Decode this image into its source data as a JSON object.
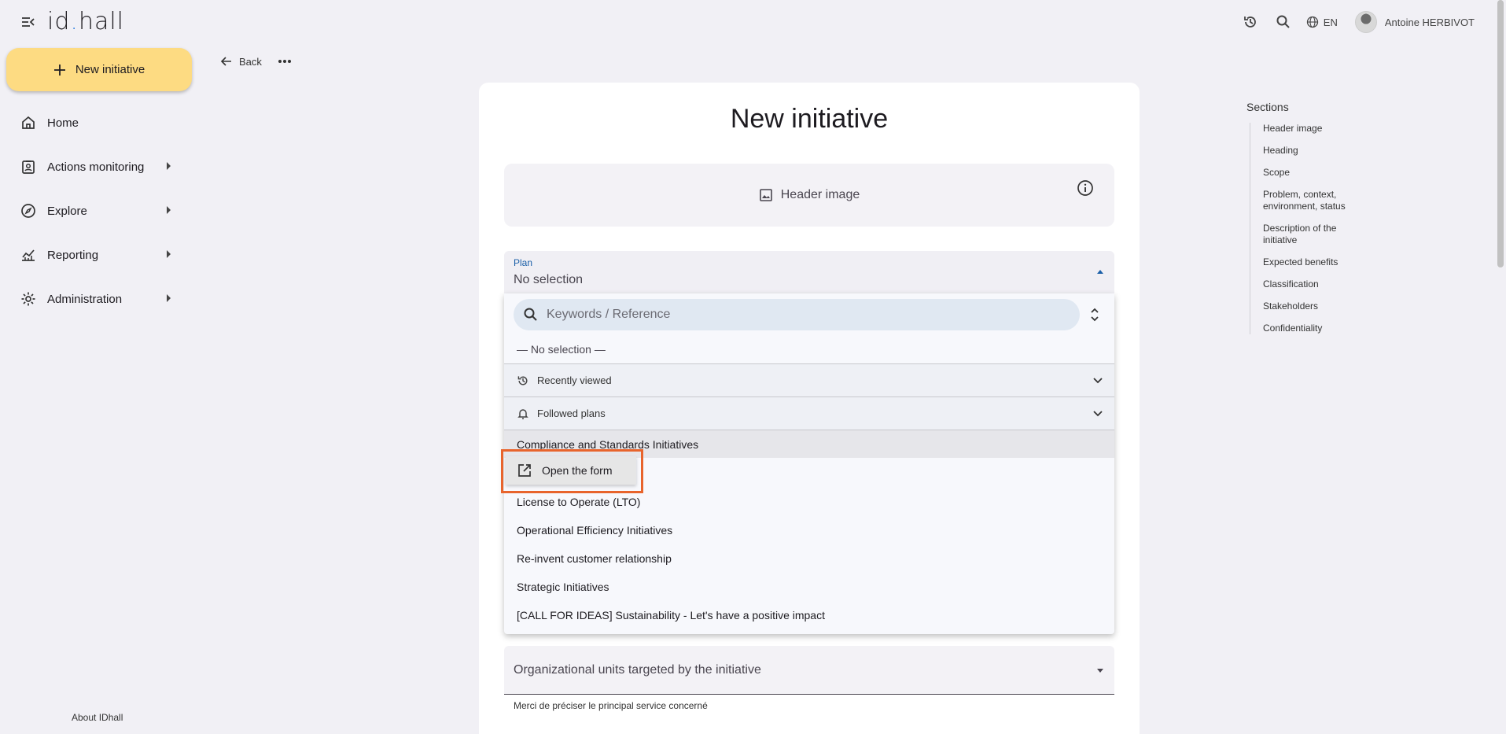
{
  "app": {
    "logo_text": "idhall"
  },
  "topbar": {
    "language": "EN",
    "user_name": "Antoine HERBIVOT"
  },
  "sidebar": {
    "new_button_label": "New initiative",
    "items": [
      {
        "label": "Home",
        "icon": "home-icon"
      },
      {
        "label": "Actions monitoring",
        "icon": "clipboard-person-icon"
      },
      {
        "label": "Explore",
        "icon": "compass-icon"
      },
      {
        "label": "Reporting",
        "icon": "chart-icon"
      },
      {
        "label": "Administration",
        "icon": "gear-icon"
      }
    ],
    "about_label": "About IDhall"
  },
  "toolbar": {
    "back_label": "Back"
  },
  "main": {
    "title": "New initiative",
    "header_image_label": "Header image",
    "plan": {
      "label": "Plan",
      "value": "No selection"
    },
    "org_units": {
      "label": "Organizational units targeted by the initiative",
      "hint": "Merci de préciser le principal service concerné"
    }
  },
  "dropdown": {
    "search_placeholder": "Keywords / Reference",
    "no_selection": "— No selection —",
    "recently_viewed": "Recently viewed",
    "followed_plans": "Followed plans",
    "options": [
      "Compliance and Standards Initiatives",
      "License to Operate (LTO)",
      "Operational Efficiency Initiatives",
      "Re-invent customer relationship",
      "Strategic Initiatives",
      "[CALL FOR IDEAS] Sustainability - Let's have a positive impact"
    ],
    "context_menu_label": "Open the form"
  },
  "sections": {
    "title": "Sections",
    "items": [
      "Header image",
      "Heading",
      "Scope",
      "Problem, context, environment, status",
      "Description of the initiative",
      "Expected benefits",
      "Classification",
      "Stakeholders",
      "Confidentiality"
    ]
  },
  "colors": {
    "accent": "#1a5fa8",
    "new_button": "#fddb82",
    "highlight": "#e8642c"
  }
}
